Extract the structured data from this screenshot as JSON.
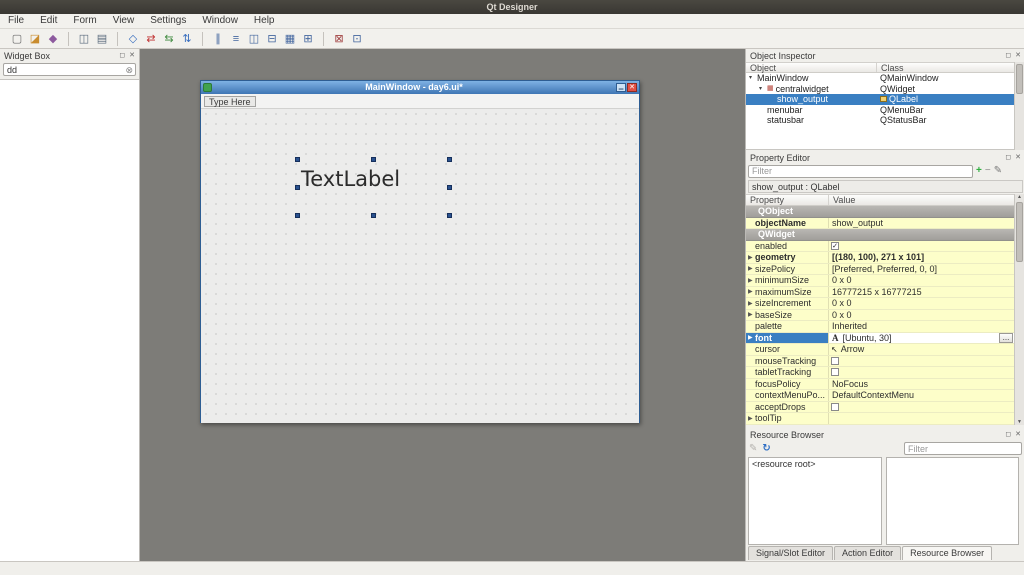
{
  "window": {
    "title": "Qt Designer"
  },
  "menubar": {
    "items": [
      "File",
      "Edit",
      "Form",
      "View",
      "Settings",
      "Window",
      "Help"
    ]
  },
  "toolbar": {
    "groups": [
      [
        {
          "name": "new-form-icon",
          "glyph": "▢",
          "color": "#6a6a6a"
        },
        {
          "name": "open-form-icon",
          "glyph": "◪",
          "color": "#c98c2e"
        },
        {
          "name": "save-form-icon",
          "glyph": "◆",
          "color": "#8d5a9e"
        }
      ],
      [
        {
          "name": "copy-icon",
          "glyph": "◫",
          "color": "#5a6b7d"
        },
        {
          "name": "paste-icon",
          "glyph": "▤",
          "color": "#5a6b7d"
        }
      ],
      [
        {
          "name": "edit-widgets-icon",
          "glyph": "◇",
          "color": "#3a6fbf"
        },
        {
          "name": "edit-signals-slots-icon",
          "glyph": "⇄",
          "color": "#c03030"
        },
        {
          "name": "edit-buddies-icon",
          "glyph": "⇆",
          "color": "#3f8a3f"
        },
        {
          "name": "edit-tab-order-icon",
          "glyph": "⇅",
          "color": "#3a6fbf"
        }
      ],
      [
        {
          "name": "layout-horizontally-icon",
          "glyph": "∥",
          "color": "#44679f"
        },
        {
          "name": "layout-vertically-icon",
          "glyph": "≡",
          "color": "#44679f"
        },
        {
          "name": "layout-splitter-horizontal-icon",
          "glyph": "◫",
          "color": "#44679f"
        },
        {
          "name": "layout-splitter-vertical-icon",
          "glyph": "⊟",
          "color": "#44679f"
        },
        {
          "name": "layout-form-icon",
          "glyph": "▦",
          "color": "#44679f"
        },
        {
          "name": "layout-grid-icon",
          "glyph": "⊞",
          "color": "#44679f"
        }
      ],
      [
        {
          "name": "break-layout-icon",
          "glyph": "⊠",
          "color": "#a04040"
        },
        {
          "name": "adjust-size-icon",
          "glyph": "⊡",
          "color": "#44679f"
        }
      ]
    ]
  },
  "icons": {
    "float": "◻",
    "close": "✕",
    "clear": "⊗",
    "reload": "↻",
    "pencil": "✎",
    "plus": "+",
    "minus": "−",
    "expander_open": "▾",
    "expander_closed": "▶",
    "check": "✓",
    "cursor": "↖",
    "minimize": "▁",
    "font_preview": "A",
    "scroll_up": "▲",
    "scroll_down": "▼"
  },
  "widget_box": {
    "title": "Widget Box",
    "filter_value": "dd"
  },
  "form": {
    "title": "MainWindow - day6.ui*",
    "menu_placeholder": "Type Here",
    "label_text": "TextLabel"
  },
  "object_inspector": {
    "title": "Object Inspector",
    "columns": [
      "Object",
      "Class"
    ],
    "rows": [
      {
        "object": "MainWindow",
        "class": "QMainWindow",
        "depth": 0,
        "expander": true
      },
      {
        "object": "centralwidget",
        "class": "QWidget",
        "depth": 1,
        "expander": true,
        "icon": {
          "glyph": "▦",
          "color": "#b33a2e"
        },
        "icon_name": "widget-icon"
      },
      {
        "object": "show_output",
        "class": "QLabel",
        "depth": 2,
        "selected": true,
        "class_icon": true
      },
      {
        "object": "menubar",
        "class": "QMenuBar",
        "depth": 1
      },
      {
        "object": "statusbar",
        "class": "QStatusBar",
        "depth": 1
      }
    ]
  },
  "property_editor": {
    "title": "Property Editor",
    "filter_placeholder": "Filter",
    "object_label": "show_output : QLabel",
    "columns": [
      "Property",
      "Value"
    ],
    "rows": [
      {
        "type": "group",
        "property": "QObject"
      },
      {
        "type": "prop",
        "property": "objectName",
        "value": "show_output",
        "bold": true
      },
      {
        "type": "group",
        "property": "QWidget"
      },
      {
        "type": "prop",
        "property": "enabled",
        "value": "",
        "checkbox": true,
        "checked": true
      },
      {
        "type": "prop",
        "property": "geometry",
        "value": "[(180, 100), 271 x 101]",
        "bold": true,
        "bold_val": true,
        "expand": true
      },
      {
        "type": "prop",
        "property": "sizePolicy",
        "value": "[Preferred, Preferred, 0, 0]",
        "expand": true
      },
      {
        "type": "prop",
        "property": "minimumSize",
        "value": "0 x 0",
        "expand": true
      },
      {
        "type": "prop",
        "property": "maximumSize",
        "value": "16777215 x 16777215",
        "expand": true
      },
      {
        "type": "prop",
        "property": "sizeIncrement",
        "value": "0 x 0",
        "expand": true
      },
      {
        "type": "prop",
        "property": "baseSize",
        "value": "0 x 0",
        "expand": true
      },
      {
        "type": "prop",
        "property": "palette",
        "value": "Inherited"
      },
      {
        "type": "prop",
        "property": "font",
        "value": "[Ubuntu, 30]",
        "bold": true,
        "selected": true,
        "expand": true,
        "font_preview": true,
        "button": "..."
      },
      {
        "type": "prop",
        "property": "cursor",
        "value": "Arrow",
        "cursor_icon": true
      },
      {
        "type": "prop",
        "property": "mouseTracking",
        "value": "",
        "checkbox": true,
        "checked": false
      },
      {
        "type": "prop",
        "property": "tabletTracking",
        "value": "",
        "checkbox": true,
        "checked": false
      },
      {
        "type": "prop",
        "property": "focusPolicy",
        "value": "NoFocus"
      },
      {
        "type": "prop",
        "property": "contextMenuPo...",
        "value": "DefaultContextMenu"
      },
      {
        "type": "prop",
        "property": "acceptDrops",
        "value": "",
        "checkbox": true,
        "checked": false
      },
      {
        "type": "prop",
        "property": "toolTip",
        "value": "",
        "expand": true
      }
    ]
  },
  "resource_browser": {
    "title": "Resource Browser",
    "filter_placeholder": "Filter",
    "tree_root": "<resource root>"
  },
  "bottom_tabs": [
    {
      "label": "Signal/Slot Editor",
      "active": false
    },
    {
      "label": "Action Editor",
      "active": false
    },
    {
      "label": "Resource Browser",
      "active": true
    }
  ]
}
